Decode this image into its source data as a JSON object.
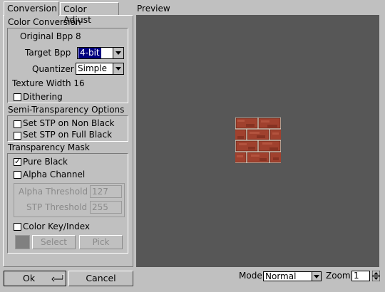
{
  "tabs": [
    {
      "label": "Conversion"
    },
    {
      "label": "Color Adjust"
    }
  ],
  "preview_label": "Preview",
  "color_conversion": {
    "title": "Color Conversion",
    "original_bpp": "Original Bpp 8",
    "target_bpp_label": "Target Bpp",
    "target_bpp_value": "4-bit",
    "quantizer_label": "Quantizer",
    "quantizer_value": "Simple",
    "texture_width": "Texture Width 16",
    "dithering_label": "Dithering",
    "dithering_checked": false
  },
  "semi_transparency": {
    "title": "Semi-Transparency Options",
    "stp_non_black": "Set STP on Non Black",
    "stp_full_black": "Set STP on Full Black"
  },
  "transparency_mask": {
    "title": "Transparency Mask",
    "pure_black": "Pure Black",
    "pure_black_checked": true,
    "alpha_channel": "Alpha Channel",
    "alpha_threshold_label": "Alpha Threshold",
    "alpha_threshold_value": "127",
    "stp_threshold_label": "STP Threshold",
    "stp_threshold_value": "255",
    "color_key_label": "Color Key/Index",
    "select_button": "Select",
    "pick_button": "Pick"
  },
  "buttons": {
    "ok": "Ok",
    "cancel": "Cancel"
  },
  "bottom": {
    "mode_label": "Mode",
    "mode_value": "Normal",
    "zoom_label": "Zoom",
    "zoom_value": "1"
  },
  "colors": {
    "window_bg": "#c0c0c0",
    "preview_bg": "#575757",
    "selection": "#000080",
    "brick": "#a0412e",
    "mortar": "#d8d0c0"
  },
  "preview_image": "brick-texture"
}
